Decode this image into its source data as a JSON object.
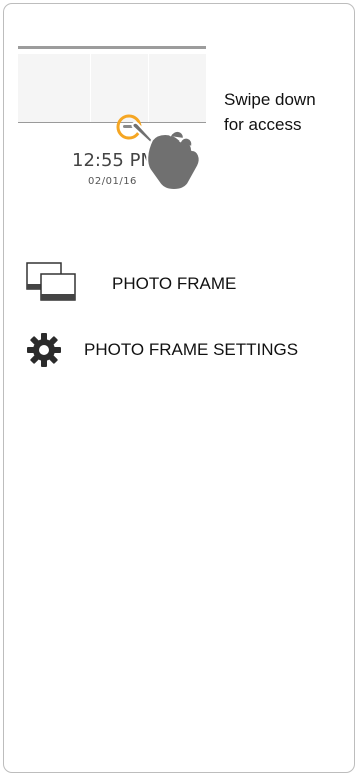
{
  "illustration": {
    "clock_time": "12:55 PM",
    "clock_date": "02/01/16",
    "hint_line1": "Swipe down",
    "hint_line2": "for access",
    "accent_color": "#f5a623"
  },
  "menu": {
    "items": [
      {
        "label": "PHOTO FRAME",
        "icon": "photo-frame-icon"
      },
      {
        "label": "PHOTO FRAME SETTINGS",
        "icon": "gear-icon"
      }
    ]
  }
}
